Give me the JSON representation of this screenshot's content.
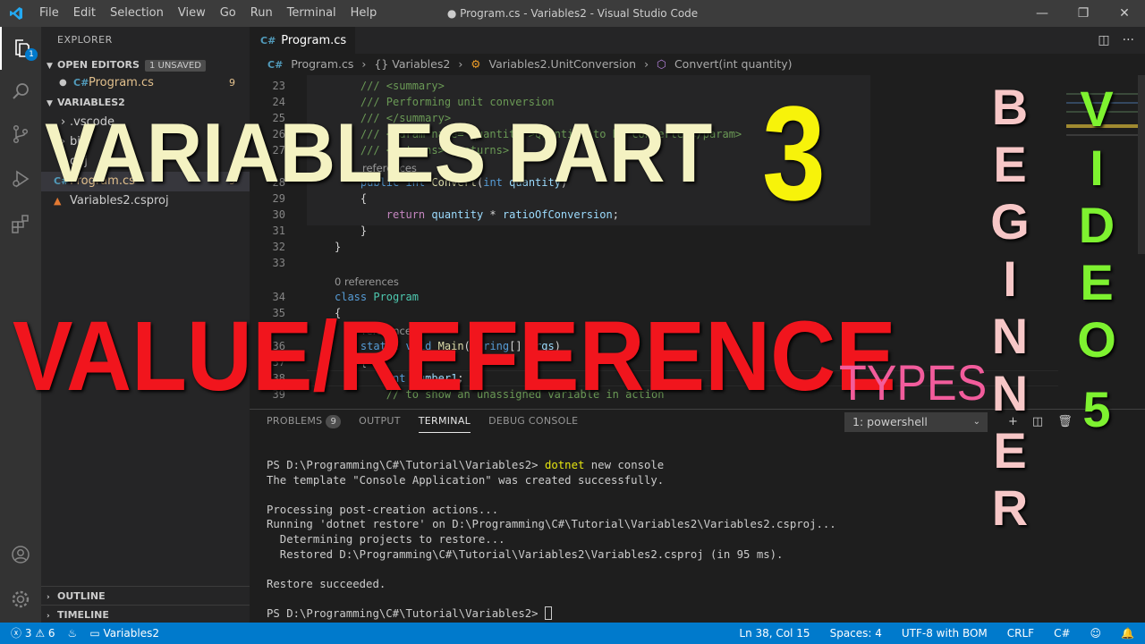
{
  "titlebar": {
    "menu": [
      "File",
      "Edit",
      "Selection",
      "View",
      "Go",
      "Run",
      "Terminal",
      "Help"
    ],
    "window_title": "● Program.cs - Variables2 - Visual Studio Code"
  },
  "activity": {
    "explorer_badge": "1"
  },
  "sidebar": {
    "title": "EXPLORER",
    "open_editors": "OPEN EDITORS",
    "unsaved_badge": "1 UNSAVED",
    "open_file": "Program.cs",
    "open_file_count": "9",
    "project": "VARIABLES2",
    "files": [
      ".vscode",
      "bin",
      "obj",
      "Program.cs",
      "Variables2.csproj"
    ],
    "file_program_count": "9",
    "outline": "OUTLINE",
    "timeline": "TIMELINE"
  },
  "editor": {
    "tab_label": "Program.cs",
    "breadcrumb": [
      "Program.cs",
      "{} Variables2",
      "Variables2.UnitConversion",
      "Convert(int quantity)"
    ],
    "line_numbers": [
      "23",
      "24",
      "25",
      "26",
      "27",
      "28",
      "29",
      "30",
      "31",
      "32",
      "33",
      "34",
      "35",
      "36",
      "37",
      "38",
      "39"
    ],
    "codelens_refs": "0 references",
    "codelens_refs_top": "references",
    "codelens_refs_35": "references"
  },
  "panel": {
    "tabs": [
      "PROBLEMS",
      "OUTPUT",
      "TERMINAL",
      "DEBUG CONSOLE"
    ],
    "problems_count": "9",
    "terminal_select": "1: powershell",
    "terminal_lines": [
      "PS D:\\Programming\\C#\\Tutorial\\Variables2> ",
      "dotnet",
      " new console",
      "The template \"Console Application\" was created successfully.",
      "",
      "Processing post-creation actions...",
      "Running 'dotnet restore' on D:\\Programming\\C#\\Tutorial\\Variables2\\Variables2.csproj...",
      "  Determining projects to restore...",
      "  Restored D:\\Programming\\C#\\Tutorial\\Variables2\\Variables2.csproj (in 95 ms).",
      "",
      "Restore succeeded.",
      "",
      "PS D:\\Programming\\C#\\Tutorial\\Variables2> "
    ]
  },
  "statusbar": {
    "errors": "3",
    "warnings": "6",
    "project": "Variables2",
    "position": "Ln 38, Col 15",
    "spaces": "Spaces: 4",
    "encoding": "UTF-8 with BOM",
    "eol": "CRLF",
    "language": "C#"
  },
  "overlay": {
    "title": "VARIABLES PART",
    "number": "3",
    "subtitle": "VALUE/REFERENCE",
    "types": "TYPES",
    "beginner": [
      "B",
      "E",
      "G",
      "I",
      "N",
      "N",
      "E",
      "R"
    ],
    "video": [
      "V",
      "I",
      "D",
      "E",
      "O",
      "5"
    ]
  }
}
